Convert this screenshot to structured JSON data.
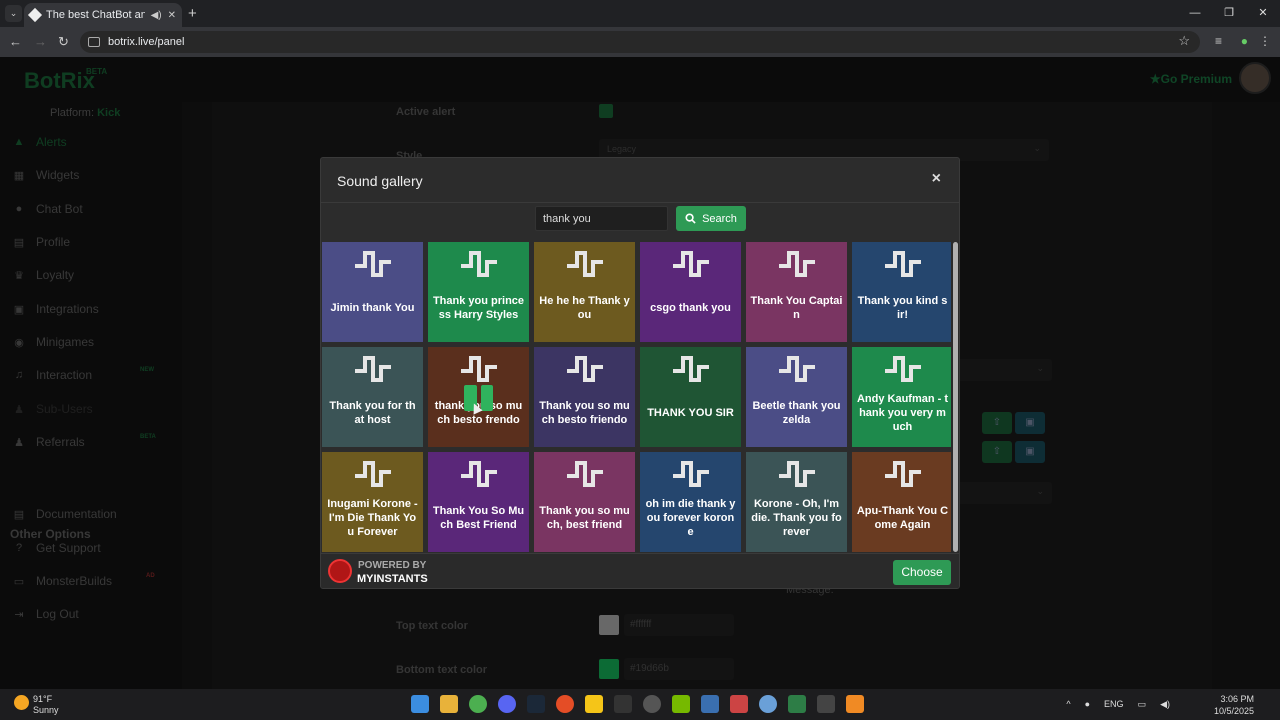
{
  "browser": {
    "tab_title": "The best ChatBot and Widg",
    "url": "botrix.live/panel"
  },
  "app": {
    "logo": "BotRix",
    "logo_badge": "BETA",
    "platform_label": "Platform:",
    "platform_value": "Kick",
    "premium_label": "Go Premium",
    "sidebar": [
      {
        "label": "Alerts",
        "icon": "triangle-icon",
        "state": "active"
      },
      {
        "label": "Widgets",
        "icon": "grid-icon"
      },
      {
        "label": "Chat Bot",
        "icon": "chat-icon"
      },
      {
        "label": "Profile",
        "icon": "id-card-icon"
      },
      {
        "label": "Loyalty",
        "icon": "trophy-icon"
      },
      {
        "label": "Integrations",
        "icon": "plug-icon"
      },
      {
        "label": "Minigames",
        "icon": "gamepad-icon"
      },
      {
        "label": "Interaction",
        "icon": "music-icon",
        "badge": "NEW"
      },
      {
        "label": "Sub-Users",
        "icon": "users-icon",
        "state": "disabled"
      },
      {
        "label": "Referrals",
        "icon": "people-icon",
        "badge": "BETA"
      }
    ],
    "other_options_heading": "Other Options",
    "other_options": [
      {
        "label": "Documentation",
        "icon": "book-icon"
      },
      {
        "label": "Get Support",
        "icon": "question-icon"
      },
      {
        "label": "MonsterBuilds",
        "icon": "monitor-icon",
        "badge": "AD"
      },
      {
        "label": "Log Out",
        "icon": "logout-icon"
      }
    ],
    "form": {
      "active_alert_label": "Active alert",
      "style_label": "Style",
      "style_value": "Legacy",
      "message_label": "Message:",
      "top_text_color_label": "Top text color",
      "top_text_color_value": "#ffffff",
      "bottom_text_color_label": "Bottom text color",
      "bottom_text_color_value": "#19d66b"
    }
  },
  "modal": {
    "title": "Sound gallery",
    "close_glyph": "×",
    "search_value": "thank you",
    "search_button": "Search",
    "sounds": [
      {
        "label": "Jimin thank You",
        "color": "#4b4d86"
      },
      {
        "label": "Thank you princess Harry Styles",
        "color": "#1e8a4c"
      },
      {
        "label": "He he he Thank you",
        "color": "#6d5a1f"
      },
      {
        "label": "csgo thank you",
        "color": "#5a2779"
      },
      {
        "label": "Thank You Captain",
        "color": "#7a3562"
      },
      {
        "label": "Thank you kind sir!",
        "color": "#25466e"
      },
      {
        "label": "Thank you for that host",
        "color": "#3b5456"
      },
      {
        "label": "thank you so much besto frendo",
        "color": "#5a2f1d"
      },
      {
        "label": "Thank you so much besto friendo",
        "color": "#3c3563"
      },
      {
        "label": "THANK YOU SIR",
        "color": "#1f5534"
      },
      {
        "label": "Beetle thank you zelda",
        "color": "#4b4d86"
      },
      {
        "label": "Andy Kaufman - thank you very much",
        "color": "#1e8a4c"
      },
      {
        "label": "Inugami Korone - I'm Die Thank You Forever",
        "color": "#6d5a1f"
      },
      {
        "label": "Thank You So Much Best Friend",
        "color": "#5a2779"
      },
      {
        "label": "Thank you so much, best friend",
        "color": "#7a3562"
      },
      {
        "label": "oh im die thank you forever korone",
        "color": "#25466e"
      },
      {
        "label": "Korone - Oh, I'm die. Thank you forever",
        "color": "#3b5456"
      },
      {
        "label": "Apu-Thank You Come Again",
        "color": "#6a3b21"
      }
    ],
    "powered_by": "POWERED BY",
    "provider": "MYINSTANTS",
    "choose_button": "Choose"
  },
  "taskbar": {
    "weather_temp": "91°F",
    "weather_desc": "Sunny",
    "language": "ENG",
    "time": "3:06 PM",
    "date": "10/5/2025"
  }
}
